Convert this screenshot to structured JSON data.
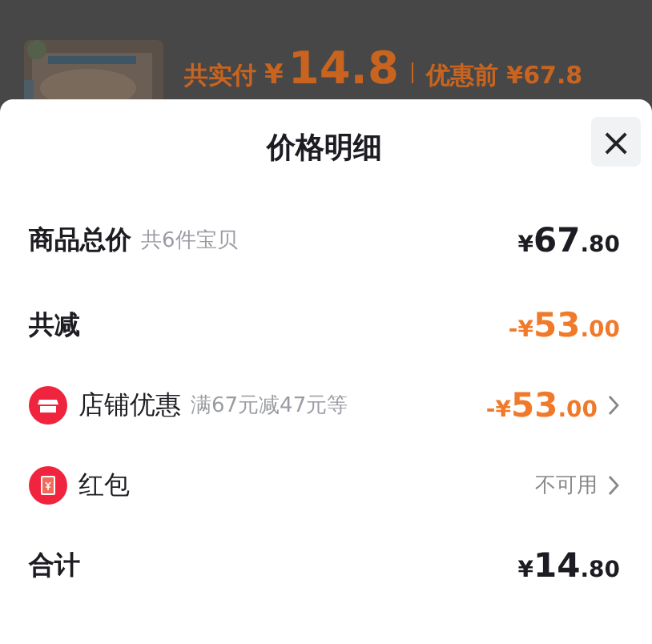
{
  "background": {
    "summary": {
      "paid_label": "共实付",
      "paid_currency": "¥",
      "paid_amount": "14.8",
      "before_label": "优惠前 ¥67.8"
    }
  },
  "sheet": {
    "title": "价格明细",
    "close": "×",
    "rows": [
      {
        "kind": "text",
        "label": "商品总价",
        "note": "共6件宝贝",
        "amount": {
          "sign": "¥",
          "whole": "67",
          "fraction": ".80"
        },
        "highlight": false,
        "chevron": false
      },
      {
        "kind": "text",
        "label": "共减",
        "amount": {
          "sign": "-¥",
          "whole": "53",
          "fraction": ".00"
        },
        "highlight": true,
        "chevron": false
      },
      {
        "kind": "store",
        "label": "店铺优惠",
        "note": "满67元减47元等",
        "amount": {
          "sign": "-¥",
          "whole": "53",
          "fraction": ".00"
        },
        "highlight": true,
        "chevron": true
      },
      {
        "kind": "packet",
        "label": "红包",
        "status": "不可用",
        "chevron": true
      },
      {
        "kind": "text",
        "label": "合计",
        "amount": {
          "sign": "¥",
          "whole": "14",
          "fraction": ".80"
        },
        "highlight": false,
        "chevron": false
      }
    ]
  }
}
